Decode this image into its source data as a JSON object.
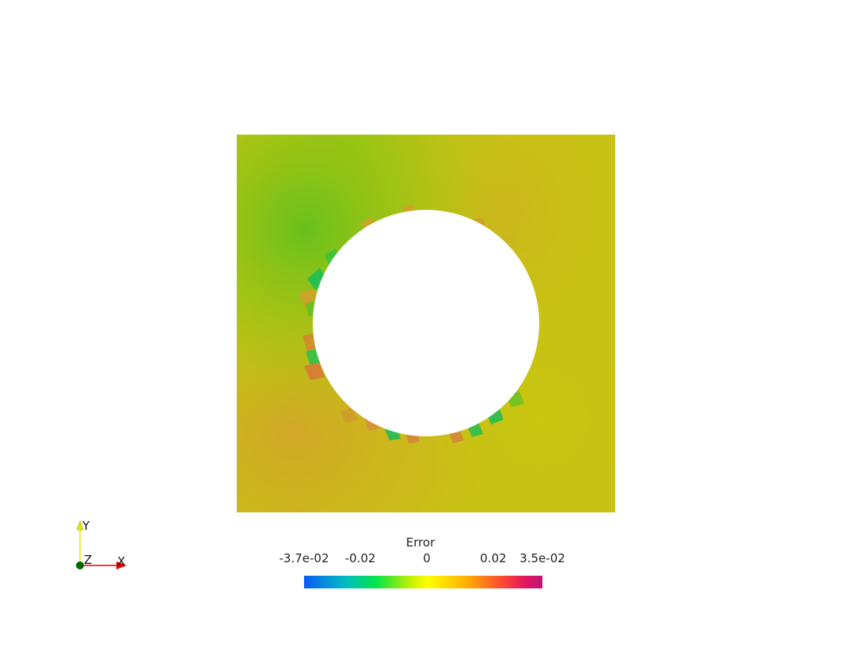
{
  "scalar_bar": {
    "title": "Error",
    "ticks": [
      {
        "label": "-3.7e-02",
        "value": -0.037
      },
      {
        "label": "-0.02",
        "value": -0.02
      },
      {
        "label": "0",
        "value": 0
      },
      {
        "label": "0.02",
        "value": 0.02
      },
      {
        "label": "3.5e-02",
        "value": 0.035
      }
    ],
    "range": [
      -0.037,
      0.035
    ],
    "colormap": [
      "#0a5cf5",
      "#00c8b4",
      "#00e44a",
      "#c8f000",
      "#ffff00",
      "#ffb000",
      "#ff5030",
      "#e6185a",
      "#c0107a"
    ]
  },
  "orientation_axes": {
    "x_label": "X",
    "y_label": "Y",
    "z_label": "Z",
    "x_color": "#dd0000",
    "y_color": "#e8e800",
    "z_color": "#006600"
  },
  "field": {
    "base_color": "#c8c214",
    "hole_color": "#ffffff"
  }
}
